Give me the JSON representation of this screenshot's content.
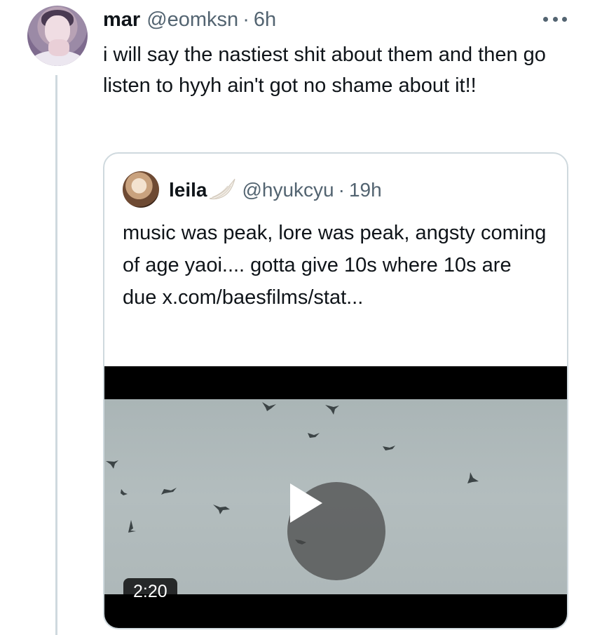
{
  "tweet": {
    "display_name": "mar",
    "handle": "@eomksn",
    "separator": "·",
    "time": "6h",
    "text": "i will say the nastiest shit about them and then go listen to hyyh ain't got no shame about it!!",
    "more_icon": "ellipsis-icon",
    "avatar_icon": "profile-avatar"
  },
  "quote": {
    "display_name": "leila",
    "badge_icon": "angel-wing-icon",
    "handle": "@hyukcyu",
    "separator": "·",
    "time": "19h",
    "text": "music was peak, lore was peak, angsty coming of age yaoi.... gotta give 10s where 10s are due x.com/baesfilms/stat...",
    "avatar_icon": "profile-avatar"
  },
  "video": {
    "duration": "2:20",
    "play_icon": "play-icon",
    "content": "birds-flying-over-grey-sky"
  },
  "colors": {
    "text_primary": "#0f1419",
    "text_secondary": "#536471",
    "border": "#cfd9de",
    "thread_line": "#cfd9de"
  }
}
